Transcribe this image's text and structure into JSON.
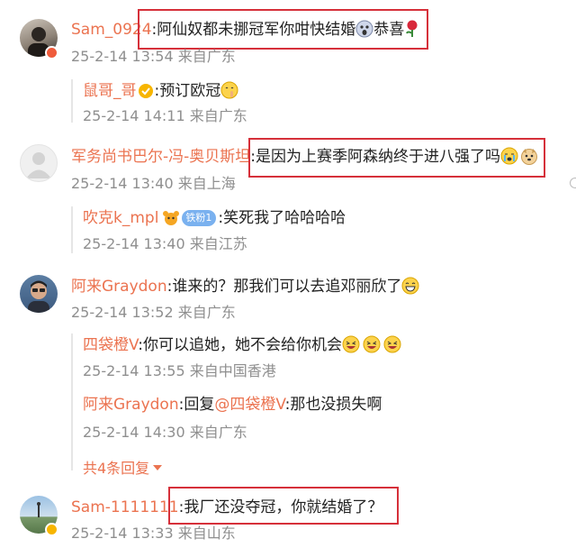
{
  "comments": [
    {
      "user": "Sam_0924",
      "text": ":阿仙奴都未挪冠军你咁快结婚",
      "text_after": "恭喜",
      "meta": "25-2-14 13:54 来自广东",
      "replies": [
        {
          "user": "鼠哥_哥",
          "text": ":预订欧冠",
          "meta": "25-2-14 14:11 来自广东"
        }
      ]
    },
    {
      "user": "军务尚书巴尔-冯-奥贝斯坦",
      "text": ":是因为上赛季阿森纳终于进八强了吗",
      "meta": "25-2-14 13:40 来自上海",
      "replies": [
        {
          "user": "吹克k_mpl",
          "fan_badge": "铁粉1",
          "text": ":笑死我了哈哈哈哈",
          "meta": "25-2-14 13:40 来自江苏"
        }
      ]
    },
    {
      "user": "阿来Graydon",
      "text": ":谁来的？那我们可以去追邓丽欣了",
      "meta": "25-2-14 13:52 来自广东",
      "replies": [
        {
          "user": "四袋橙V",
          "text": ":你可以追她，她不会给你机会",
          "meta": "25-2-14 13:55 来自中国香港"
        },
        {
          "user": "阿来Graydon",
          "text_mid": ":回复",
          "mention": "@四袋橙V",
          "text": ":那也没损失啊",
          "meta": "25-2-14 14:30 来自广东"
        }
      ],
      "more_replies": "共4条回复"
    },
    {
      "user": "Sam-1111111",
      "text": ":我厂还没夺冠，你就结婚了？",
      "meta": "25-2-14 13:33 来自山东"
    }
  ],
  "colors": {
    "username": "#eb7350",
    "meta": "#8f8f8f",
    "highlight_box": "#d6303a"
  },
  "icons": [
    "scream-emoji",
    "rose-emoji",
    "shush-emoji",
    "crying-emoji",
    "dog-emoji",
    "laughing-emoji",
    "grin-emoji",
    "vip-badge",
    "verified-badge"
  ]
}
